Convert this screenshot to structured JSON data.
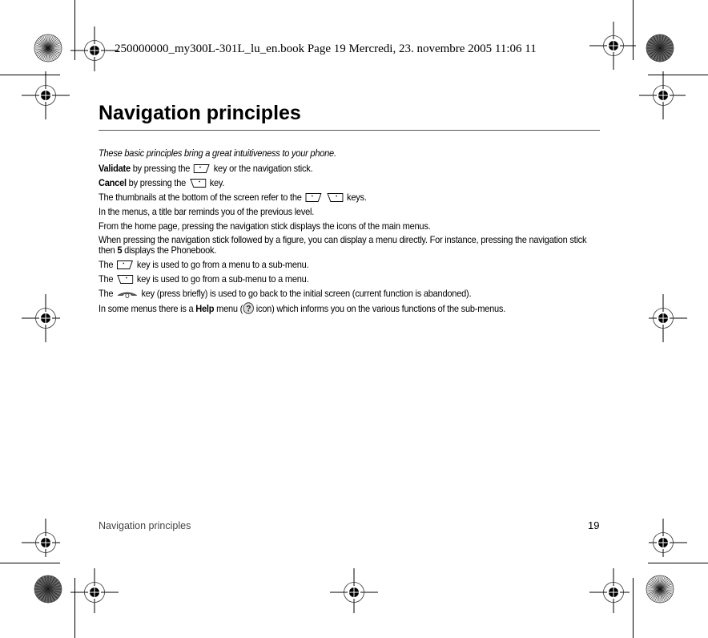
{
  "print_header": {
    "text": "250000000_my300L-301L_lu_en.book  Page 19  Mercredi, 23. novembre 2005  11:06 11"
  },
  "page": {
    "title": "Navigation principles",
    "intro": "These basic principles bring a great intuitiveness to your phone.",
    "paragraphs": {
      "validate": {
        "bold": "Validate",
        "before": " by pressing the ",
        "after": " key or the navigation stick.",
        "key_icon": "right-softkey-icon"
      },
      "cancel": {
        "bold": "Cancel",
        "before": " by pressing the ",
        "after": " key.",
        "key_icon": "left-softkey-icon"
      },
      "thumbnails": {
        "before": "The thumbnails at the bottom of the screen refer to the ",
        "after": " keys."
      },
      "title_bar": {
        "text": "In the menus, a title bar reminds you of the previous level."
      },
      "home_page": {
        "text": "From the home page, pressing the navigation stick displays the icons of the main menus."
      },
      "figure": {
        "before": "When pressing the navigation stick followed by a figure, you can display a menu directly. For instance, pressing the navigation stick then ",
        "bold": "5",
        "after": " displays the Phonebook."
      },
      "submenu": {
        "before": "The ",
        "after": " key  is used to go from a menu to a sub-menu."
      },
      "menu": {
        "before": "The ",
        "after": "  key is used to go from a sub-menu to a menu."
      },
      "end_key": {
        "before": "The ",
        "after": " key (press briefly) is used to go back to the initial screen (current function is abandoned)."
      },
      "help": {
        "before": "In some menus there is a ",
        "bold": "Help",
        "middle": " menu (",
        "after": " icon) which informs you on the various functions of the sub-menus."
      }
    }
  },
  "footer": {
    "section_title": "Navigation principles",
    "page_number": "19"
  },
  "colors": {
    "text": "#000000",
    "footer_text": "#444444",
    "rule": "#555555"
  }
}
